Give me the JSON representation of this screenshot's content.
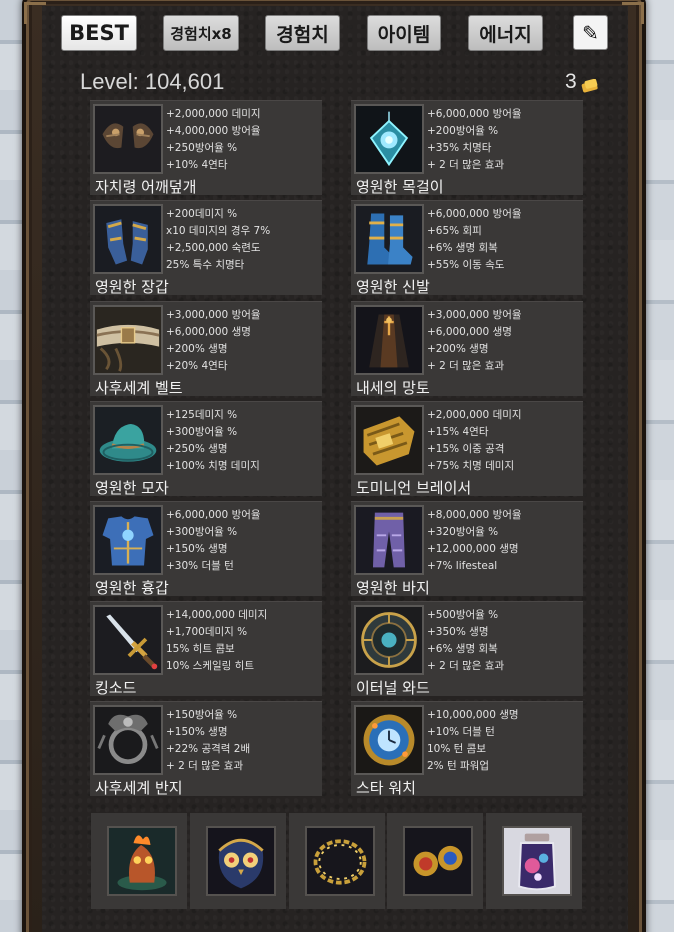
{
  "tabs": [
    "BEST",
    "경험치x8",
    "경험치",
    "아이템",
    "에너지"
  ],
  "edit_icon": "pencil-icon",
  "level": {
    "label": "Level:",
    "value": "104,601"
  },
  "currency": {
    "count": "3",
    "icon": "scroll-coin-icon"
  },
  "items": [
    {
      "name": "자치령 어깨덮개",
      "icon": "shoulder-armor-icon",
      "stats": [
        "+2,000,000 데미지",
        "+4,000,000 방어율",
        "+250방어율 %",
        "+10% 4연타"
      ]
    },
    {
      "name": "영원한 목걸이",
      "icon": "crystal-amulet-icon",
      "stats": [
        "+6,000,000 방어율",
        "+200방어율 %",
        "+35% 치명타",
        "+ 2 더 많은 효과"
      ]
    },
    {
      "name": "영원한 장갑",
      "icon": "gauntlets-icon",
      "stats": [
        "+200데미지 %",
        "x10 데미지의 경우 7%",
        "+2,500,000 숙련도",
        "25% 특수 치명타"
      ]
    },
    {
      "name": "영원한 신발",
      "icon": "boots-icon",
      "stats": [
        "+6,000,000 방어율",
        "+65% 회피",
        "+6% 생명 회복",
        "+55% 이동 속도"
      ]
    },
    {
      "name": "사후세계 벨트",
      "icon": "belt-icon",
      "stats": [
        "+3,000,000 방어율",
        "+6,000,000 생명",
        "+200% 생명",
        "+20% 4연타"
      ]
    },
    {
      "name": "내세의 망토",
      "icon": "cloak-icon",
      "stats": [
        "+3,000,000 방어율",
        "+6,000,000 생명",
        "+200% 생명",
        "+ 2 더 많은 효과"
      ]
    },
    {
      "name": "영원한 모자",
      "icon": "hat-icon",
      "stats": [
        "+125데미지 %",
        "+300방어율 %",
        "+250% 생명",
        "+100% 치명 데미지"
      ]
    },
    {
      "name": "도미니언 브레이서",
      "icon": "bracer-icon",
      "stats": [
        "+2,000,000 데미지",
        "+15% 4연타",
        "+15% 이중 공격",
        "+75% 치명 데미지"
      ]
    },
    {
      "name": "영원한 흉갑",
      "icon": "chestplate-icon",
      "stats": [
        "+6,000,000 방어율",
        "+300방어율 %",
        "+150% 생명",
        "+30% 더블 턴"
      ]
    },
    {
      "name": "영원한 바지",
      "icon": "pants-icon",
      "stats": [
        "+8,000,000 방어율",
        "+320방어율 %",
        "+12,000,000 생명",
        "+7% lifesteal"
      ]
    },
    {
      "name": "킹소드",
      "icon": "sword-icon",
      "stats": [
        "+14,000,000 데미지",
        "+1,700데미지 %",
        "15% 히트 콤보",
        "10% 스케일링 히트"
      ]
    },
    {
      "name": "이터널 와드",
      "icon": "shield-icon",
      "stats": [
        "+500방어율 %",
        "+350% 생명",
        "+6% 생명 회복",
        "+ 2 더 많은 효과"
      ]
    },
    {
      "name": "사후세계 반지",
      "icon": "ring-icon",
      "stats": [
        "+150방어율 %",
        "+150% 생명",
        "+22% 공격력 2배",
        "+ 2 더 많은 효과"
      ]
    },
    {
      "name": "스타 워치",
      "icon": "watch-icon",
      "stats": [
        "+10,000,000 생명",
        "+10% 더블 턴",
        "10% 턴 콤보",
        "2% 턴 파워업"
      ]
    }
  ],
  "bottom_slots": [
    "fire-pet-icon",
    "owl-pet-icon",
    "golden-wreath-icon",
    "twin-orbs-icon",
    "star-jar-icon"
  ]
}
